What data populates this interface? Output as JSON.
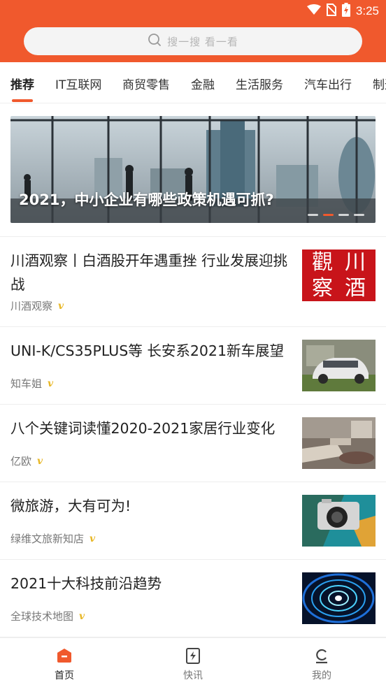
{
  "status_bar": {
    "time": "3:25",
    "icons": [
      "wifi-icon",
      "no-sim-icon",
      "battery-charging-icon"
    ]
  },
  "search": {
    "placeholder": "搜一搜 看一看",
    "icon": "search-icon"
  },
  "tabs": [
    {
      "label": "推荐",
      "active": true
    },
    {
      "label": "IT互联网"
    },
    {
      "label": "商贸零售"
    },
    {
      "label": "金融"
    },
    {
      "label": "生活服务"
    },
    {
      "label": "汽车出行"
    },
    {
      "label": "制造"
    }
  ],
  "banner": {
    "title": "2021，中小企业有哪些政策机遇可抓?",
    "slide_count": 4,
    "active_slide": 2
  },
  "articles": [
    {
      "title": "川酒观察丨白酒股开年遇重挫 行业发展迎挑战",
      "source": "川酒观察",
      "verified_icon": "v-icon",
      "thumb_text": [
        "觀",
        "川",
        "察",
        "酒"
      ]
    },
    {
      "title": "UNI-K/CS35PLUS等 长安系2021新车展望",
      "source": "知车姐",
      "verified_icon": "v-icon"
    },
    {
      "title": "八个关键词读懂2020-2021家居行业变化",
      "source": "亿欧",
      "verified_icon": "v-icon"
    },
    {
      "title": "微旅游，大有可为!",
      "source": "绿维文旅新知店",
      "verified_icon": "v-icon"
    },
    {
      "title": "2021十大科技前沿趋势",
      "source": "全球技术地图",
      "verified_icon": "v-icon"
    }
  ],
  "bottom_nav": [
    {
      "label": "首页",
      "icon": "home-icon",
      "active": true
    },
    {
      "label": "快讯",
      "icon": "flash-news-icon"
    },
    {
      "label": "我的",
      "icon": "profile-icon"
    }
  ],
  "colors": {
    "accent": "#f0592d",
    "verified": "#e8b726",
    "thumb_red": "#c8141a"
  }
}
